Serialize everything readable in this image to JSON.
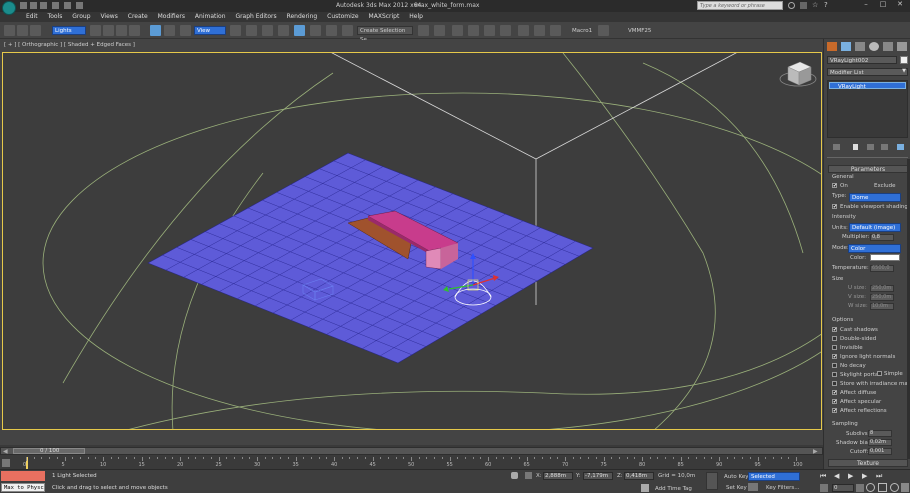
{
  "title_bar": {
    "app_title": "Autodesk 3ds Max 2012 x64",
    "file_name": "max_white_form.max",
    "search_placeholder": "Type a keyword or phrase"
  },
  "menu": [
    "Edit",
    "Tools",
    "Group",
    "Views",
    "Create",
    "Modifiers",
    "Animation",
    "Graph Editors",
    "Rendering",
    "Customize",
    "MAXScript",
    "Help"
  ],
  "toolbar": {
    "selection_filter": "Lights",
    "reference_coord": "View",
    "named_selection": "Create Selection Se",
    "macro1": "Macro1",
    "vmf_label": "VMMF25"
  },
  "viewport": {
    "label": "[ + ] [ Orthographic ] [ Shaded + Edged Faces ]"
  },
  "command_panel": {
    "object_name": "VRayLight002",
    "modifier_list": "Modifier List",
    "stack_item": "VRayLight",
    "rollout_title": "Parameters",
    "general": {
      "title": "General",
      "on_label": "On",
      "exclude_label": "Exclude",
      "type_label": "Type:",
      "type_value": "Dome",
      "viewport_shading_label": "Enable viewport shading"
    },
    "intensity": {
      "title": "Intensity",
      "units_label": "Units:",
      "units_value": "Default (image)",
      "multiplier_label": "Multiplier:",
      "multiplier_value": "0,8",
      "mode_label": "Mode:",
      "mode_value": "Color",
      "color_label": "Color:",
      "temperature_label": "Temperature:",
      "temperature_value": "6500,0"
    },
    "size": {
      "title": "Size",
      "u_label": "U size:",
      "u_value": "250,0m",
      "v_label": "V size:",
      "v_value": "250,0m",
      "w_label": "W size:",
      "w_value": "10,0m"
    },
    "options": {
      "title": "Options",
      "items": [
        {
          "label": "Cast shadows",
          "checked": true
        },
        {
          "label": "Double-sided",
          "checked": false
        },
        {
          "label": "Invisible",
          "checked": false
        },
        {
          "label": "Ignore light normals",
          "checked": true
        },
        {
          "label": "No decay",
          "checked": false
        },
        {
          "label": "Skylight portal",
          "checked": false
        },
        {
          "label": "Store with irradiance map",
          "checked": false
        },
        {
          "label": "Affect diffuse",
          "checked": true
        },
        {
          "label": "Affect specular",
          "checked": true
        },
        {
          "label": "Affect reflections",
          "checked": true
        }
      ],
      "simple_label": "Simple"
    },
    "sampling": {
      "title": "Sampling",
      "subdivs_label": "Subdivs:",
      "subdivs_value": "8",
      "shadow_bias_label": "Shadow bias:",
      "shadow_bias_value": "0,02m",
      "cutoff_label": "Cutoff:",
      "cutoff_value": "0,001"
    },
    "texture_title": "Texture"
  },
  "timeline": {
    "frame_readout": "0 / 100",
    "ticks": [
      "0",
      "5",
      "10",
      "15",
      "20",
      "25",
      "30",
      "35",
      "40",
      "45",
      "50",
      "55",
      "60",
      "65",
      "70",
      "75",
      "80",
      "85",
      "90",
      "95",
      "100"
    ]
  },
  "status": {
    "maxscript_label": "Max to Physc",
    "selection_info": "1 Light Selected",
    "prompt": "Click and drag to select and move objects",
    "x_label": "X:",
    "x_value": "2,888m",
    "y_label": "Y:",
    "y_value": "-7,179m",
    "z_label": "Z:",
    "z_value": "0,418m",
    "grid_label": "Grid = 10,0m",
    "add_time_tag": "Add Time Tag",
    "auto_key": "Auto Key",
    "selected_value": "Selected",
    "set_key": "Set Key",
    "key_filters": "Key Filters...",
    "current_frame": "0"
  },
  "colors": {
    "grid_plane": "#5e5bd8",
    "bench_top": "#c83c8c",
    "bench_wood": "#a0522d",
    "viewport_border": "#e6c94a",
    "dome_lines": "#9ab07a",
    "accent_blue": "#2f6fd6"
  }
}
